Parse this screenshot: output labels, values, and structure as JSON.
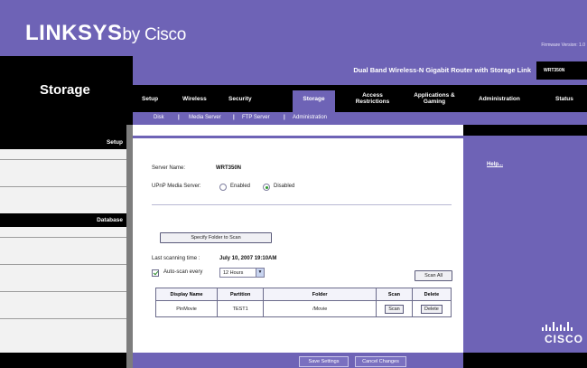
{
  "header": {
    "brand": "LINKSYS",
    "by": "by Cisco",
    "firmware": "Firmware Version: 1.0"
  },
  "section": {
    "title": "Storage"
  },
  "product": {
    "name": "Dual Band Wireless-N Gigabit Router with Storage Link",
    "model": "WRT350N"
  },
  "tabs": [
    {
      "label": "Setup"
    },
    {
      "label": "Wireless"
    },
    {
      "label": "Security"
    },
    {
      "label": "Storage"
    },
    {
      "label": "Access\nRestrictions"
    },
    {
      "label": "Applications &\nGaming"
    },
    {
      "label": "Administration"
    },
    {
      "label": "Status"
    }
  ],
  "subtabs": [
    {
      "label": "Disk"
    },
    {
      "label": "Media Server"
    },
    {
      "label": "FTP Server"
    },
    {
      "label": "Administration"
    }
  ],
  "sidebar": {
    "setup": "Setup",
    "database": "Database"
  },
  "form": {
    "server_name_label": "Server Name:",
    "server_name_value": "WRT350N",
    "upnp_label": "UPnP Media Server:",
    "enabled_label": "Enabled",
    "disabled_label": "Disabled",
    "specify_btn": "Specify Folder to Scan",
    "last_scan_label": "Last scanning time :",
    "last_scan_value": "July 10, 2007 19:10AM",
    "auto_scan_label": "Auto-scan every",
    "auto_scan_value": "12 Hours",
    "scan_all_btn": "Scan All"
  },
  "table": {
    "headers": [
      "Display Name",
      "Partition",
      "Folder",
      "Scan",
      "Delete"
    ],
    "rows": [
      {
        "display_name": "PinMovie",
        "partition": "TEST1",
        "folder": "/Movie",
        "scan": "Scan",
        "delete": "Delete"
      }
    ]
  },
  "right": {
    "help": "Help..."
  },
  "footer": {
    "save": "Save Settings",
    "cancel": "Cancel Changes"
  },
  "colors": {
    "brand_purple": "#6e63b6",
    "nav_black": "#000000"
  }
}
